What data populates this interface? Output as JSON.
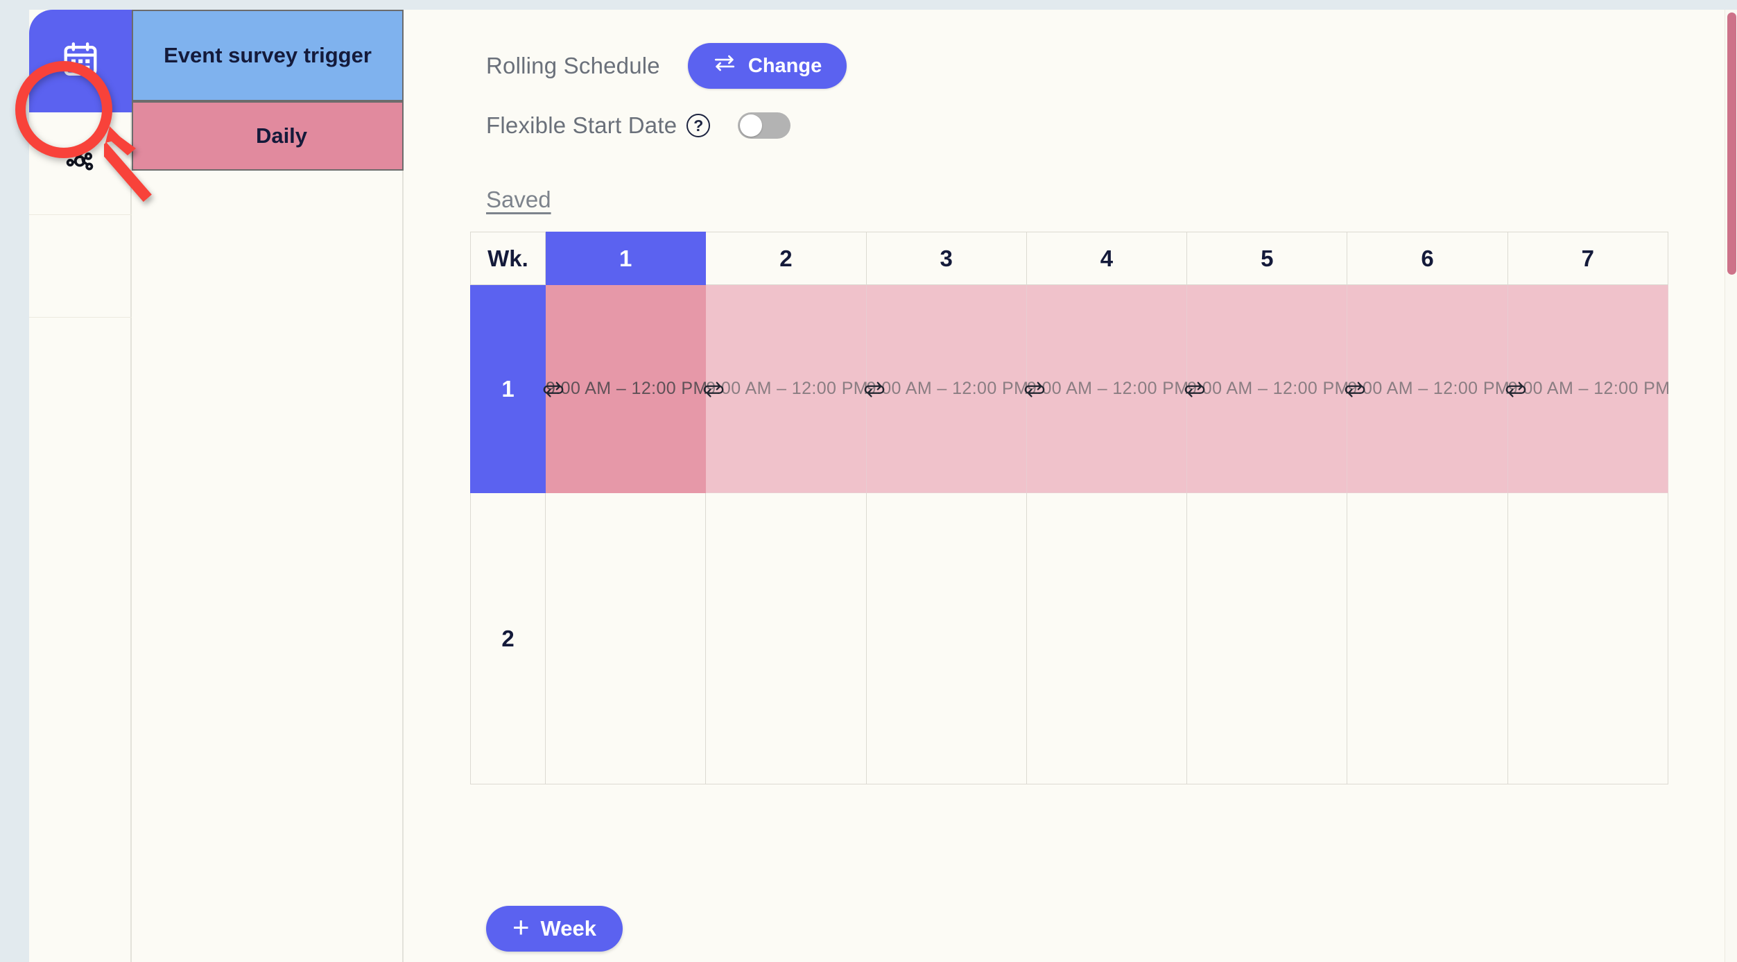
{
  "sidebar": {
    "items": [
      {
        "icon": "calendar-icon",
        "name": "calendar",
        "active": true
      },
      {
        "icon": "network-hub-icon",
        "name": "network",
        "active": false
      },
      {
        "icon": "blank-icon",
        "name": "blank",
        "active": false
      }
    ]
  },
  "panel": {
    "tabs": [
      {
        "label": "Event survey trigger",
        "color": "#7fb2ee"
      },
      {
        "label": "Daily",
        "color": "#e18a9e"
      }
    ]
  },
  "controls": {
    "rolling_schedule_label": "Rolling Schedule",
    "change_button_label": "Change",
    "change_button_icon": "swap-arrows-icon",
    "flexible_start_date_label": "Flexible Start Date",
    "help_icon_glyph": "?",
    "flexible_start_date_toggle": "off",
    "saved_label": "Saved"
  },
  "schedule": {
    "week_header_label": "Wk.",
    "columns": [
      "1",
      "2",
      "3",
      "4",
      "5",
      "6",
      "7"
    ],
    "selected_column": "1",
    "rows": [
      {
        "week": "1",
        "selected": true,
        "cells": [
          {
            "time": "9:00 AM – 12:00 PM",
            "icon": "repeat-icon",
            "state": "active"
          },
          {
            "time": "9:00 AM – 12:00 PM",
            "icon": "repeat-icon",
            "state": "faded"
          },
          {
            "time": "9:00 AM – 12:00 PM",
            "icon": "repeat-icon",
            "state": "faded"
          },
          {
            "time": "9:00 AM – 12:00 PM",
            "icon": "repeat-icon",
            "state": "faded"
          },
          {
            "time": "9:00 AM – 12:00 PM",
            "icon": "repeat-icon",
            "state": "faded"
          },
          {
            "time": "9:00 AM – 12:00 PM",
            "icon": "repeat-icon",
            "state": "faded"
          },
          {
            "time": "9:00 AM – 12:00 PM",
            "icon": "repeat-icon",
            "state": "faded"
          }
        ]
      },
      {
        "week": "2",
        "selected": false,
        "cells": [
          {
            "time": "",
            "state": "empty"
          },
          {
            "time": "",
            "state": "empty"
          },
          {
            "time": "",
            "state": "empty"
          },
          {
            "time": "",
            "state": "empty"
          },
          {
            "time": "",
            "state": "empty"
          },
          {
            "time": "",
            "state": "empty"
          },
          {
            "time": "",
            "state": "empty"
          }
        ]
      }
    ]
  },
  "footer": {
    "add_week_label": "Week",
    "add_week_plus": "+"
  },
  "annotations": {
    "highlight_shape": "circle",
    "highlight_color": "#f8423a",
    "pointer_shape": "arrow",
    "pointer_color": "#f8423a"
  },
  "colors": {
    "accent_blue": "#5b62f0",
    "tab_blue": "#7fb2ee",
    "tab_pink": "#e18a9e",
    "cell_pink_active": "#e698a8",
    "cell_pink_faded": "#f0c2cb",
    "page_bg": "#fcfbf5",
    "chrome_gray": "#e2eaee",
    "scrollbar_thumb": "#cd7289"
  }
}
